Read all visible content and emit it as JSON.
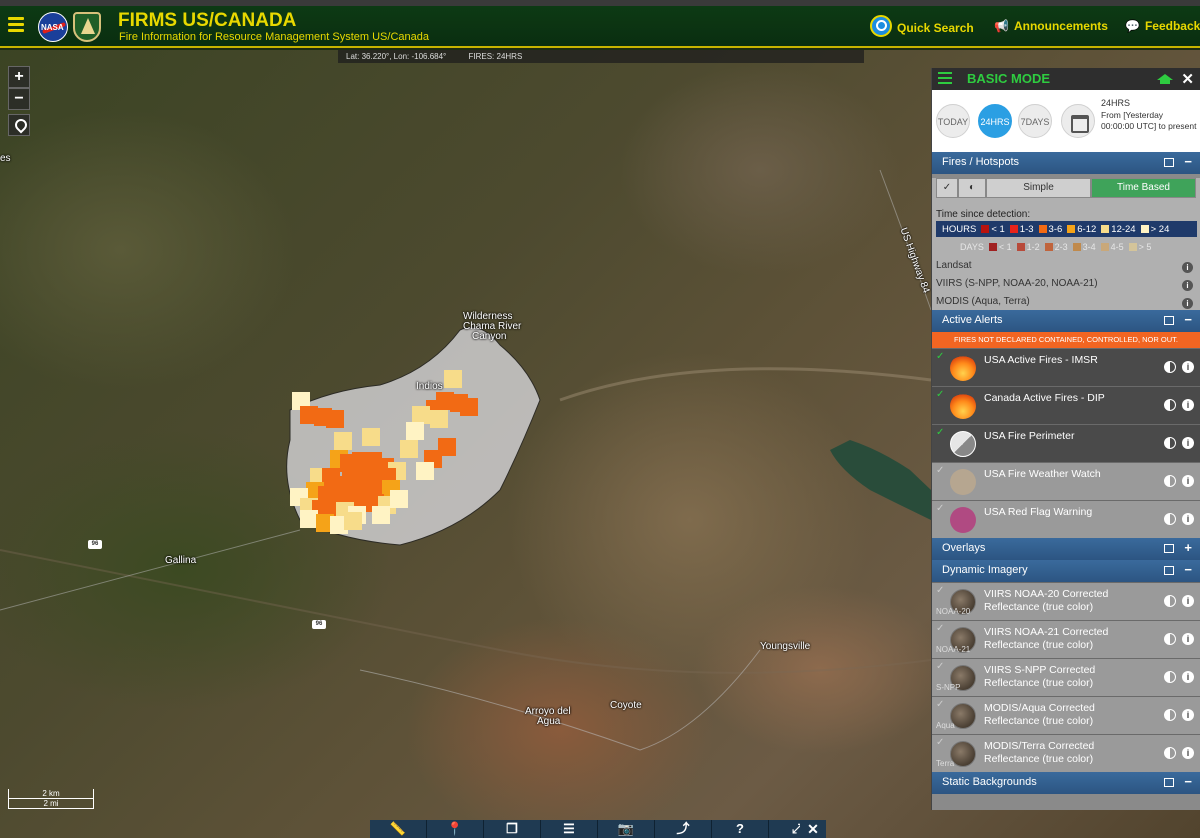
{
  "header": {
    "title": "FIRMS US/CANADA",
    "subtitle": "Fire Information for Resource Management System US/Canada",
    "quick_search": "Quick Search",
    "announcements": "Announcements",
    "feedback": "Feedback",
    "nasa_logo_text": "NASA"
  },
  "map": {
    "coord_text": "Lat: 36.220°, Lon: -106.684°",
    "fires_text": "FIRES: 24HRS",
    "zoom_in": "+",
    "zoom_out": "−",
    "labels": {
      "wilderness": "Wilderness",
      "chama": "Chama River",
      "canyon": "Canyon",
      "indios": "Indios",
      "gallina": "Gallina",
      "youngsville": "Youngsville",
      "arroyo": "Arroyo del",
      "agua": "Agua",
      "coyote": "Coyote",
      "us_highway": "US Highway 84",
      "es": "es"
    },
    "road_96a": "96",
    "road_96b": "96",
    "scale_km": "2 km",
    "scale_mi": "2 mi"
  },
  "toolbar": {
    "close": "✕",
    "buttons": [
      "📏",
      "📍",
      "❐",
      "☰",
      "📷",
      "⤴",
      "?",
      "⤢"
    ]
  },
  "sidebar": {
    "mode": "BASIC MODE",
    "close": "✕",
    "time": {
      "today": "TODAY",
      "h24": "24HRS",
      "d7": "7DAYS",
      "range_title": "24HRS",
      "range_desc": "From [Yesterday 00:00:00 UTC] to present"
    },
    "fires_section": {
      "title": "Fires / Hotspots",
      "simple": "Simple",
      "time_based": "Time Based",
      "time_since": "Time since detection:",
      "hours_label": "HOURS",
      "hours": [
        {
          "label": "< 1",
          "color": "#b8130e"
        },
        {
          "label": "1-3",
          "color": "#e8231a"
        },
        {
          "label": "3-6",
          "color": "#f26a14"
        },
        {
          "label": "6-12",
          "color": "#f5a318"
        },
        {
          "label": "12-24",
          "color": "#f7dc8a"
        },
        {
          "label": "> 24",
          "color": "#fff3c4"
        }
      ],
      "days_label": "DAYS",
      "days": [
        {
          "label": "< 1",
          "color": "#a02020"
        },
        {
          "label": "1-2",
          "color": "#b84a3a"
        },
        {
          "label": "2-3",
          "color": "#c0643c"
        },
        {
          "label": "3-4",
          "color": "#c08a4c"
        },
        {
          "label": "4-5",
          "color": "#c9a87a"
        },
        {
          "label": "> 5",
          "color": "#d4c49a"
        }
      ],
      "landsat": "Landsat",
      "viirs": "VIIRS (S-NPP, NOAA-20, NOAA-21)",
      "modis": "MODIS (Aqua, Terra)"
    },
    "alerts": {
      "title": "Active Alerts",
      "banner": "FIRES NOT DECLARED CONTAINED, CONTROLLED, NOR OUT.",
      "layers": [
        {
          "label": "USA Active Fires - IMSR"
        },
        {
          "label": "Canada Active Fires - DIP"
        },
        {
          "label": "USA Fire Perimeter"
        },
        {
          "label": "USA Fire Weather Watch"
        },
        {
          "label": "USA Red Flag Warning"
        }
      ]
    },
    "overlays": "Overlays",
    "dynamic": {
      "title": "Dynamic Imagery",
      "layers": [
        {
          "label": "VIIRS NOAA-20 Corrected Reflectance (true color)",
          "sub": "NOAA-20"
        },
        {
          "label": "VIIRS NOAA-21 Corrected Reflectance (true color)",
          "sub": "NOAA-21"
        },
        {
          "label": "VIIRS S-NPP Corrected Reflectance (true color)",
          "sub": "S-NPP"
        },
        {
          "label": "MODIS/Aqua Corrected Reflectance (true color)",
          "sub": "Aqua"
        },
        {
          "label": "MODIS/Terra Corrected Reflectance (true color)",
          "sub": "Terra"
        }
      ]
    },
    "static_bg": "Static Backgrounds",
    "info_glyph": "i",
    "minus": "−",
    "plus": "+",
    "check": "✓"
  }
}
